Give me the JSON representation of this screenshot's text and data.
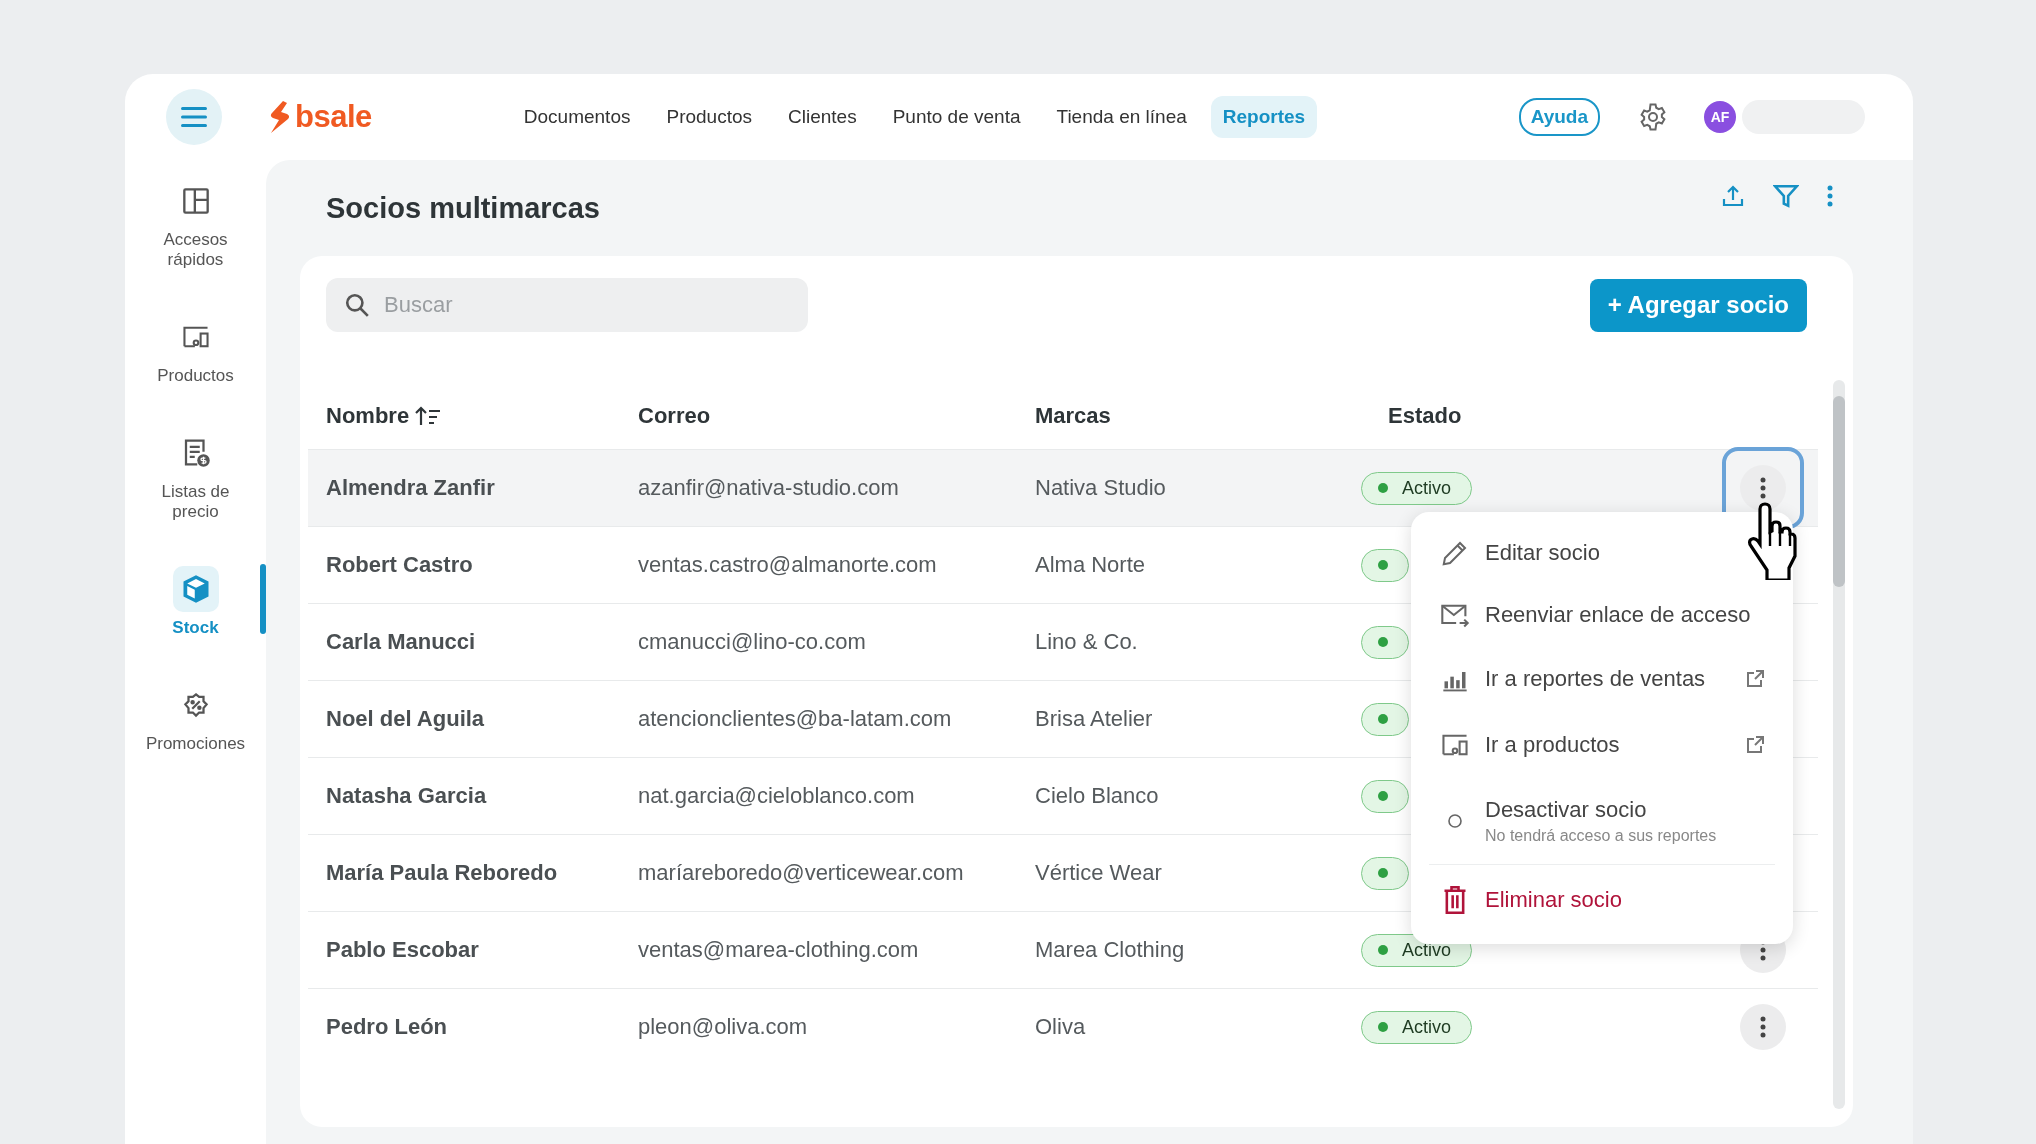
{
  "brand": "bsale",
  "nav": [
    {
      "label": "Documentos",
      "selected": false
    },
    {
      "label": "Productos",
      "selected": false
    },
    {
      "label": "Clientes",
      "selected": false
    },
    {
      "label": "Punto de venta",
      "selected": false
    },
    {
      "label": "Tienda en línea",
      "selected": false
    },
    {
      "label": "Reportes",
      "selected": true
    }
  ],
  "help": "Ayuda",
  "avatar": "AF",
  "sidebar": {
    "items": [
      {
        "label": "Accesos rápidos",
        "selected": false
      },
      {
        "label": "Productos",
        "selected": false
      },
      {
        "label": "Listas de precio",
        "selected": false
      },
      {
        "label": "Stock",
        "selected": true
      },
      {
        "label": "Promociones",
        "selected": false
      }
    ]
  },
  "page": {
    "title": "Socios multimarcas"
  },
  "search": {
    "placeholder": "Buscar"
  },
  "add_button": "+ Agregar socio",
  "table": {
    "columns": [
      "Nombre",
      "Correo",
      "Marcas",
      "Estado"
    ],
    "rows": [
      {
        "name": "Almendra Zanfir",
        "email": "azanfir@nativa-studio.com",
        "brand": "Nativa Studio",
        "status": {
          "label": "Activo",
          "active": true
        },
        "selected": true,
        "actions": true
      },
      {
        "name": "Robert Castro",
        "email": "ventas.castro@almanorte.com",
        "brand": "Alma Norte",
        "status": {
          "active": true
        },
        "selected": false,
        "actions": false
      },
      {
        "name": "Carla Manucci",
        "email": "cmanucci@lino-co.com",
        "brand": "Lino & Co.",
        "status": {
          "active": true
        },
        "selected": false,
        "actions": false
      },
      {
        "name": "Noel del Aguila",
        "email": "atencionclientes@ba-latam.com",
        "brand": "Brisa Atelier",
        "status": {
          "active": true
        },
        "selected": false,
        "actions": false
      },
      {
        "name": "Natasha Garcia",
        "email": "nat.garcia@cieloblanco.com",
        "brand": "Cielo Blanco",
        "status": {
          "active": true
        },
        "selected": false,
        "actions": false
      },
      {
        "name": "María Paula Reboredo",
        "email": "maríareboredo@verticewear.com",
        "brand": "Vértice Wear",
        "status": {
          "active": true
        },
        "selected": false,
        "actions": false
      },
      {
        "name": "Pablo Escobar",
        "email": "ventas@marea-clothing.com",
        "brand": "Marea Clothing",
        "status": {
          "label": "Activo",
          "active": true
        },
        "selected": false,
        "actions": true
      },
      {
        "name": "Pedro León",
        "email": "pleon@oliva.com",
        "brand": "Oliva",
        "status": {
          "label": "Activo",
          "active": true
        },
        "selected": false,
        "actions": true
      }
    ]
  },
  "menu": {
    "items": [
      {
        "kind": "edit",
        "label": "Editar socio"
      },
      {
        "kind": "resend",
        "label": "Reenviar enlace de acceso"
      },
      {
        "kind": "sales",
        "label": "Ir a reportes de ventas",
        "external": true
      },
      {
        "kind": "products",
        "label": "Ir a productos",
        "external": true
      },
      {
        "kind": "deactivate",
        "label": "Desactivar socio",
        "hint": "No tendrá acceso a sus reportes"
      },
      {
        "kind": "delete",
        "label": "Eliminar socio",
        "danger": true
      }
    ]
  }
}
